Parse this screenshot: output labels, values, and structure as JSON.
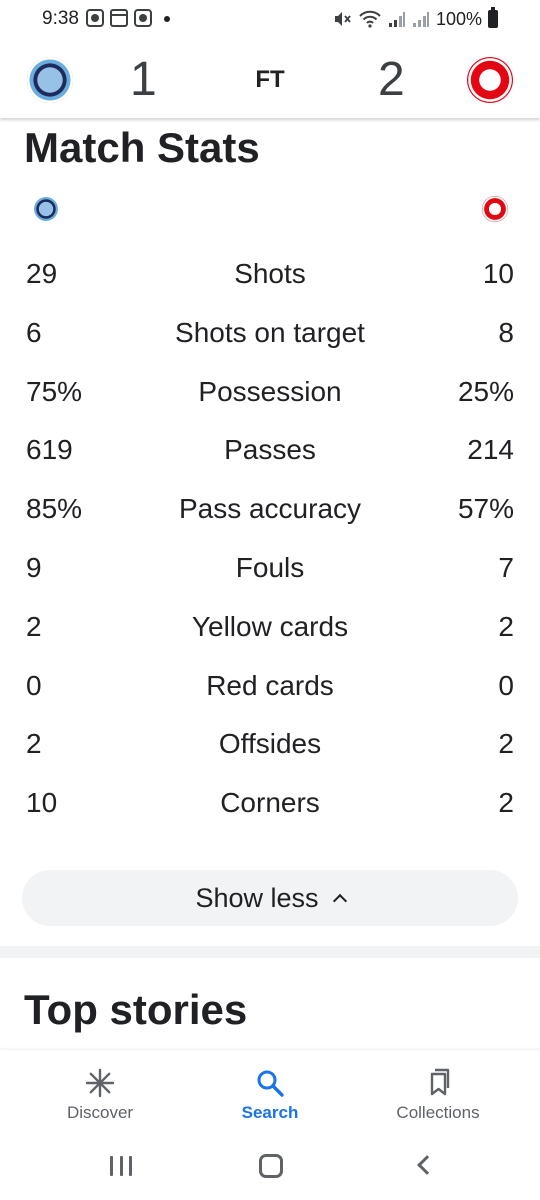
{
  "status_bar": {
    "time": "9:38",
    "battery": "100%"
  },
  "match": {
    "home_score": "1",
    "away_score": "2",
    "status": "FT",
    "home_colors": {
      "primary": "#6caddf",
      "secondary": "#1c2c5b"
    },
    "away_colors": {
      "primary": "#e30613",
      "secondary": "#ffffff"
    }
  },
  "stats_section": {
    "title": "Match Stats",
    "rows": [
      {
        "label": "Shots",
        "home": "29",
        "away": "10"
      },
      {
        "label": "Shots on target",
        "home": "6",
        "away": "8"
      },
      {
        "label": "Possession",
        "home": "75%",
        "away": "25%"
      },
      {
        "label": "Passes",
        "home": "619",
        "away": "214"
      },
      {
        "label": "Pass accuracy",
        "home": "85%",
        "away": "57%"
      },
      {
        "label": "Fouls",
        "home": "9",
        "away": "7"
      },
      {
        "label": "Yellow cards",
        "home": "2",
        "away": "2"
      },
      {
        "label": "Red cards",
        "home": "0",
        "away": "0"
      },
      {
        "label": "Offsides",
        "home": "2",
        "away": "2"
      },
      {
        "label": "Corners",
        "home": "10",
        "away": "2"
      }
    ],
    "show_less_label": "Show less"
  },
  "top_stories": {
    "title": "Top stories"
  },
  "bottom_nav": {
    "items": [
      {
        "label": "Discover",
        "icon": "asterisk-icon",
        "active": false
      },
      {
        "label": "Search",
        "icon": "search-icon",
        "active": true
      },
      {
        "label": "Collections",
        "icon": "bookmarks-icon",
        "active": false
      }
    ],
    "active_color": "#1a73e8"
  }
}
